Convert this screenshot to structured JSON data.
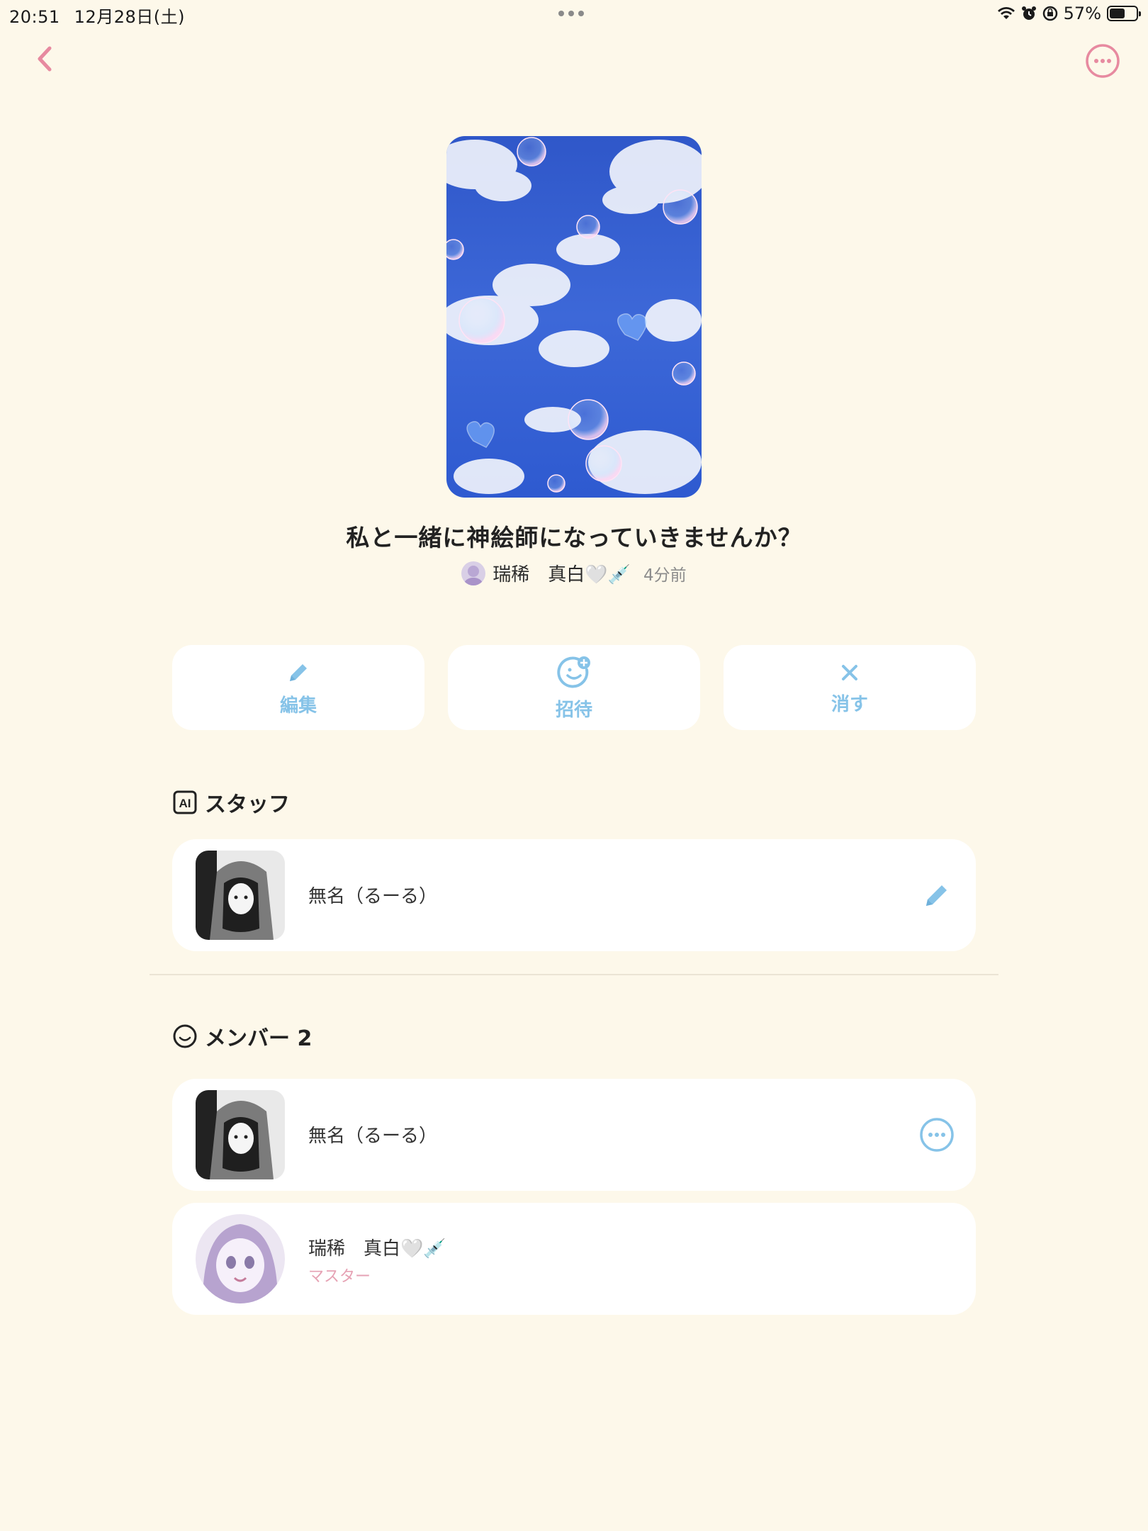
{
  "status_bar": {
    "time": "20:51",
    "date": "12月28日(土)",
    "battery_percent": "57%",
    "battery_level": 0.57
  },
  "header": {
    "back_icon": "chevron-left-icon",
    "more_icon": "ellipsis-circle-icon",
    "accent_color": "#e78aa0"
  },
  "project": {
    "title": "私と一緒に神絵師になっていきませんか？",
    "author": "瑞稀　真白🤍💉",
    "time_ago": "4分前"
  },
  "actions": [
    {
      "label": "編集",
      "icon": "pencil-icon"
    },
    {
      "label": "招待",
      "icon": "add-person-icon"
    },
    {
      "label": "消す",
      "icon": "close-icon"
    }
  ],
  "staff": {
    "heading": "スタッフ",
    "icon": "ai-icon",
    "items": [
      {
        "name": "無名（るーる）",
        "action_icon": "pencil-icon"
      }
    ]
  },
  "members": {
    "heading": "メンバー 2",
    "icon": "smile-icon",
    "items": [
      {
        "name": "無名（るーる）",
        "action_icon": "ellipsis-circle-icon"
      },
      {
        "name": "瑞稀　真白🤍💉",
        "role": "マスター"
      }
    ]
  },
  "colors": {
    "background": "#fdf8ea",
    "action_blue": "#86c3e8",
    "master_pink": "#e6a2b4"
  }
}
